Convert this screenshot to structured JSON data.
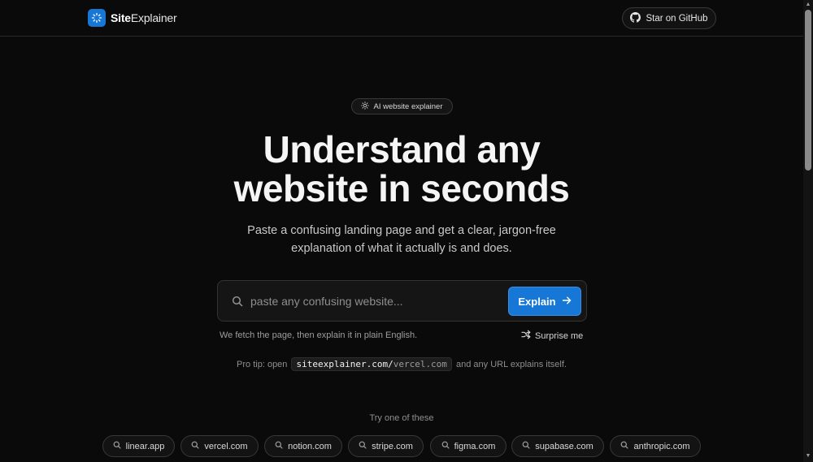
{
  "header": {
    "brand_bold": "Site",
    "brand_rest": "Explainer",
    "github_label": "Star on GitHub"
  },
  "hero": {
    "pill_label": "AI website explainer",
    "title_line1": "Understand any",
    "title_line2": "website in seconds",
    "subtitle_line1": "Paste a confusing landing page and get a clear, jargon-free",
    "subtitle_line2": "explanation of what it actually is and does."
  },
  "search": {
    "placeholder": "paste any confusing website...",
    "value": "",
    "button_label": "Explain",
    "help_text": "We fetch the page, then explain it in plain English.",
    "surprise_label": "Surprise me"
  },
  "tip": {
    "prefix": "Pro tip: open",
    "code_host": "siteexplainer.com/",
    "code_path": "vercel.com",
    "suffix": "and any URL explains itself."
  },
  "examples": {
    "label": "Try one of these",
    "items": [
      "linear.app",
      "vercel.com",
      "notion.com",
      "stripe.com",
      "figma.com",
      "supabase.com",
      "anthropic.com"
    ]
  },
  "colors": {
    "background": "#0b0a0a",
    "accent": "#1677d6"
  },
  "icons": {
    "brand": "loader-icon",
    "github": "github-icon",
    "pill": "sparkle-icon",
    "search": "search-icon",
    "explain": "arrow-right-icon",
    "surprise": "shuffle-icon",
    "chip": "search-icon"
  }
}
